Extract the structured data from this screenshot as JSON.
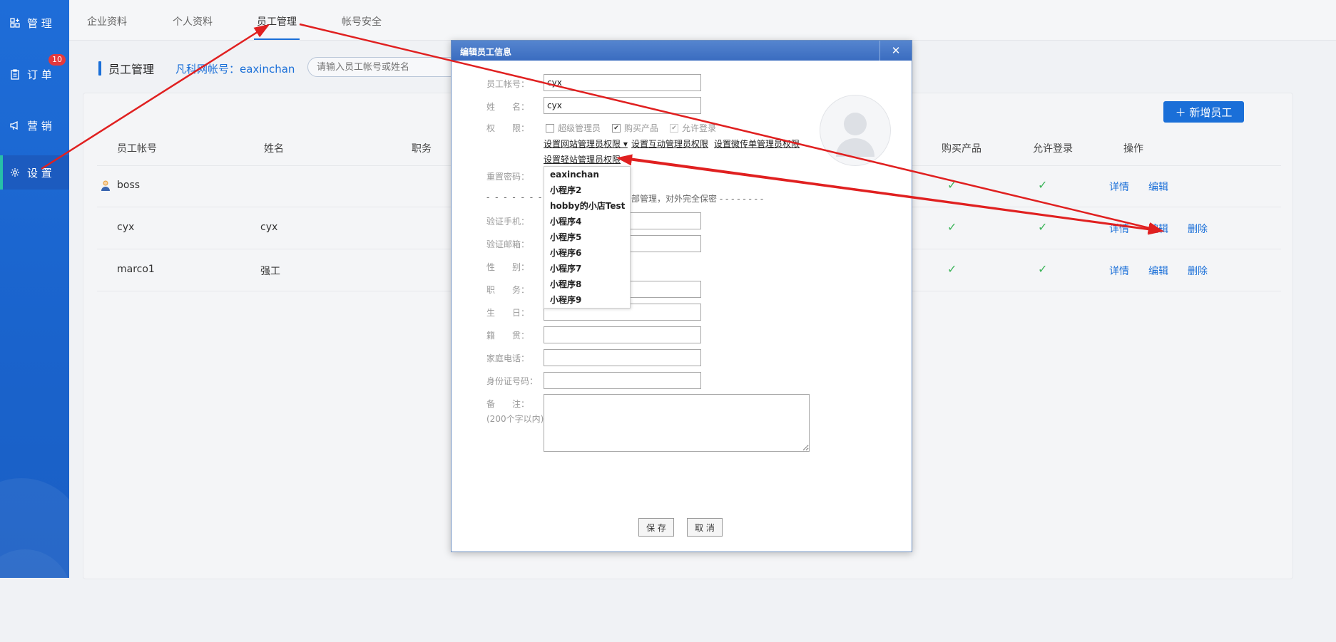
{
  "sidebar": {
    "items": [
      {
        "label": "管 理",
        "icon": "grid-plus-icon"
      },
      {
        "label": "订 单",
        "icon": "clipboard-icon",
        "badge": "10"
      },
      {
        "label": "营 销",
        "icon": "megaphone-icon"
      },
      {
        "label": "设 置",
        "icon": "gear-icon",
        "active": true
      }
    ]
  },
  "tabs": [
    "企业资料",
    "个人资料",
    "员工管理",
    "帐号安全"
  ],
  "active_tab": "员工管理",
  "page": {
    "title": "员工管理",
    "account_label": "凡科网帐号：eaxinchan",
    "search_placeholder": "请输入员工帐号或姓名",
    "add_button": "＋  新增员工"
  },
  "table": {
    "headers": [
      "员工帐号",
      "姓名",
      "职务",
      "购买产品",
      "允许登录",
      "操作"
    ],
    "rows": [
      {
        "account": "boss",
        "name": "",
        "buy": "✓",
        "login": "✓",
        "actions": [
          "详情",
          "编辑"
        ]
      },
      {
        "account": "cyx",
        "name": "cyx",
        "buy": "✓",
        "login": "✓",
        "actions": [
          "详情",
          "编辑",
          "删除"
        ]
      },
      {
        "account": "marco1",
        "name": "强工",
        "buy": "✓",
        "login": "✓",
        "actions": [
          "详情",
          "编辑",
          "删除"
        ]
      }
    ]
  },
  "modal": {
    "title": "编辑员工信息",
    "close": "✕",
    "labels": {
      "account": "员工帐号：",
      "name": "姓　　名：",
      "perm": "权　　限：",
      "reset": "重置密码：",
      "phone": "验证手机：",
      "email": "验证邮箱：",
      "gender": "性　　别：",
      "job": "职　　务：",
      "birthday": "生　　日：",
      "native": "籍　　贯：",
      "home_phone": "家庭电话：",
      "id_card": "身份证号码：",
      "remark": "备　　注：",
      "remark_hint": "(200个字以内)"
    },
    "values": {
      "account": "cyx",
      "name": "cyx"
    },
    "checkboxes": [
      {
        "label": "超级管理员",
        "checked": false
      },
      {
        "label": "购买产品",
        "checked": true
      },
      {
        "label": "允许登录",
        "checked": true
      }
    ],
    "perm_links": [
      "设置网站管理员权限 ▾",
      "设置互动管理员权限",
      "设置微传单管理员权限",
      "设置轻站管理员权限"
    ],
    "dashes": "- - - - - - - -",
    "note_text": "部管理，对外完全保密  - - - - - - - -",
    "save": "保 存",
    "cancel": "取 消"
  },
  "dropdown": {
    "options": [
      "eaxinchan",
      "小程序2",
      "hobby的小店Test",
      "小程序4",
      "小程序5",
      "小程序6",
      "小程序7",
      "小程序8",
      "小程序9"
    ]
  },
  "colors": {
    "brand": "#1a6fd8",
    "annotation": "#e02020",
    "check": "#3db55a"
  }
}
